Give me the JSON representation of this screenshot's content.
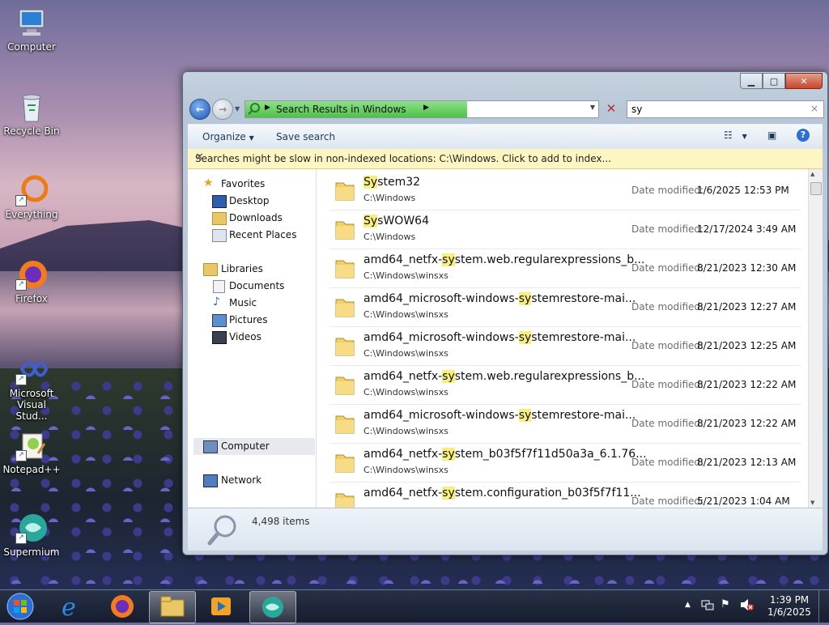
{
  "desktop": {
    "icons": [
      {
        "label": "Computer"
      },
      {
        "label": "Recycle Bin"
      },
      {
        "label": "Everything"
      },
      {
        "label": "Firefox"
      },
      {
        "label": "Microsoft Visual Stud..."
      },
      {
        "label": "Notepad++"
      },
      {
        "label": "Supermium"
      }
    ]
  },
  "window": {
    "address": {
      "crumb": "Search Results in Windows"
    },
    "search": {
      "value": "sy"
    },
    "toolbar": {
      "organize": "Organize",
      "save_search": "Save search"
    },
    "infobar": "Searches might be slow in non-indexed locations: C:\\Windows. Click to add to index...",
    "nav": {
      "favorites": "Favorites",
      "desktop": "Desktop",
      "downloads": "Downloads",
      "recent_places": "Recent Places",
      "libraries": "Libraries",
      "documents": "Documents",
      "music": "Music",
      "pictures": "Pictures",
      "videos": "Videos",
      "computer": "Computer",
      "network": "Network"
    },
    "date_label": "Date modified:",
    "files": [
      {
        "pre": "",
        "hl": "Sy",
        "post": "stem32",
        "path": "C:\\Windows",
        "date": "1/6/2025 12:53 PM"
      },
      {
        "pre": "",
        "hl": "Sy",
        "post": "sWOW64",
        "path": "C:\\Windows",
        "date": "12/17/2024 3:49 AM"
      },
      {
        "pre": "amd64_netfx-",
        "hl": "sy",
        "post": "stem.web.regularexpressions_b...",
        "path": "C:\\Windows\\winsxs",
        "date": "8/21/2023 12:30 AM"
      },
      {
        "pre": "amd64_microsoft-windows-",
        "hl": "sy",
        "post": "stemrestore-mai...",
        "path": "C:\\Windows\\winsxs",
        "date": "8/21/2023 12:27 AM"
      },
      {
        "pre": "amd64_microsoft-windows-",
        "hl": "sy",
        "post": "stemrestore-mai...",
        "path": "C:\\Windows\\winsxs",
        "date": "8/21/2023 12:25 AM"
      },
      {
        "pre": "amd64_netfx-",
        "hl": "sy",
        "post": "stem.web.regularexpressions_b...",
        "path": "C:\\Windows\\winsxs",
        "date": "8/21/2023 12:22 AM"
      },
      {
        "pre": "amd64_microsoft-windows-",
        "hl": "sy",
        "post": "stemrestore-mai...",
        "path": "C:\\Windows\\winsxs",
        "date": "8/21/2023 12:22 AM"
      },
      {
        "pre": "amd64_netfx-",
        "hl": "sy",
        "post": "stem_b03f5f7f11d50a3a_6.1.76...",
        "path": "C:\\Windows\\winsxs",
        "date": "8/21/2023 12:13 AM"
      },
      {
        "pre": "amd64_netfx-",
        "hl": "sy",
        "post": "stem.configuration_b03f5f7f11...",
        "path": "",
        "date": "5/21/2023 1:04 AM"
      }
    ],
    "status": {
      "count": "4,498 items"
    }
  },
  "taskbar": {
    "clock": {
      "time": "1:39 PM",
      "date": "1/6/2025"
    }
  },
  "colors": {
    "accent": "#1e395b",
    "highlight": "#f9f07a",
    "infobar": "#fdf6c3"
  }
}
